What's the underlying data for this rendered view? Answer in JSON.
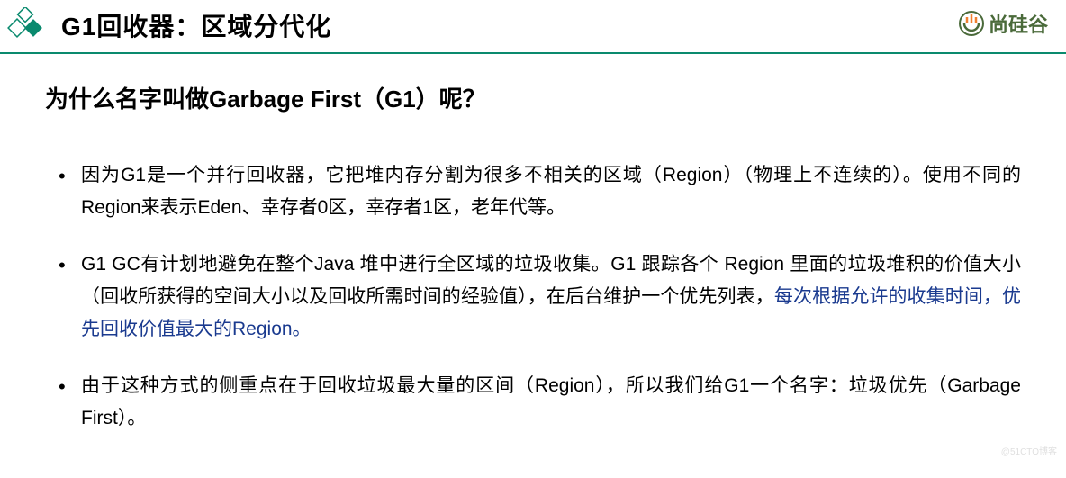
{
  "header": {
    "title": "G1回收器：区域分代化"
  },
  "brand": {
    "text": "尚硅谷"
  },
  "content": {
    "subtitle": "为什么名字叫做Garbage First（G1）呢？",
    "bullets": [
      {
        "text": "因为G1是一个并行回收器，它把堆内存分割为很多不相关的区域（Region）（物理上不连续的）。使用不同的Region来表示Eden、幸存者0区，幸存者1区，老年代等。"
      },
      {
        "text_prefix": "G1 GC有计划地避免在整个Java 堆中进行全区域的垃圾收集。G1 跟踪各个 Region 里面的垃圾堆积的价值大小（回收所获得的空间大小以及回收所需时间的经验值），在后台维护一个优先列表，",
        "text_highlight": "每次根据允许的收集时间，优先回收价值最大的Region。"
      },
      {
        "text": "由于这种方式的侧重点在于回收垃圾最大量的区间（Region），所以我们给G1一个名字：垃圾优先（Garbage First）。"
      }
    ]
  },
  "watermark": "@51CTO博客"
}
